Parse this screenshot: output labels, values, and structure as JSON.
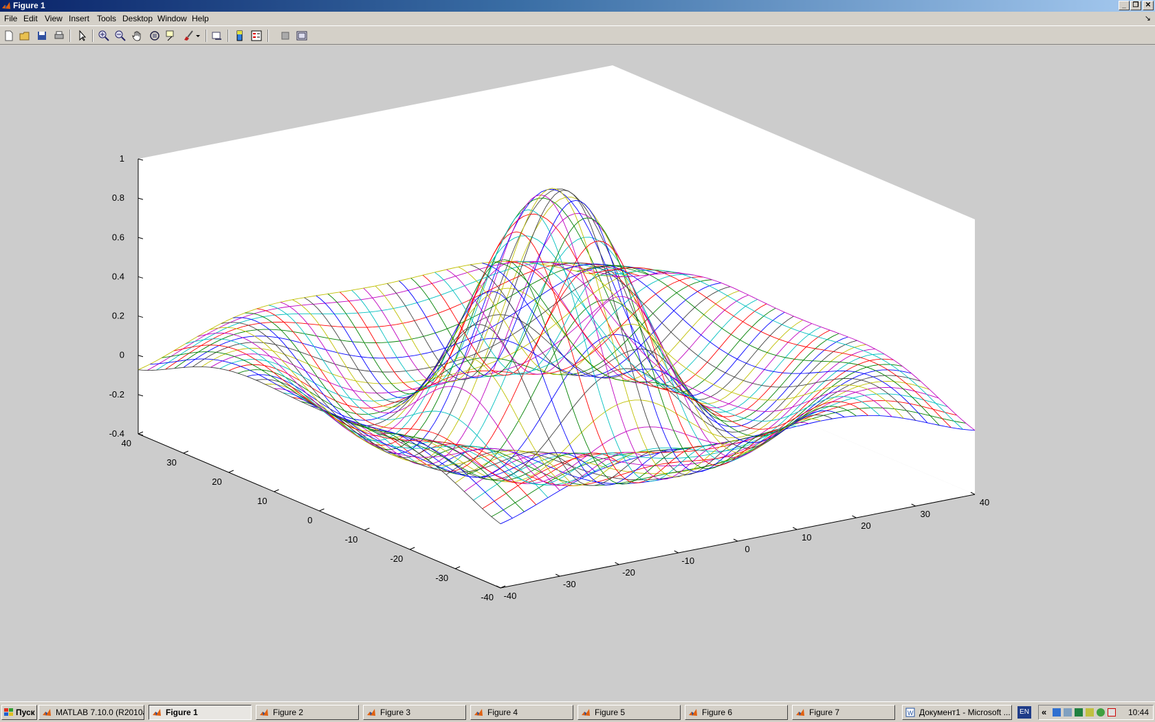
{
  "window": {
    "title": "Figure 1"
  },
  "window_buttons": [
    "minimize",
    "restore",
    "close"
  ],
  "menu": [
    "File",
    "Edit",
    "View",
    "Insert",
    "Tools",
    "Desktop",
    "Window",
    "Help"
  ],
  "toolbar": [
    "new-figure-icon",
    "open-file-icon",
    "save-icon",
    "print-icon",
    "edit-plot-icon",
    "zoom-in-icon",
    "zoom-out-icon",
    "pan-icon",
    "rotate-3d-icon",
    "data-cursor-icon",
    "brush-icon",
    "brush-dropdown-icon",
    "link-plot-icon",
    "insert-colorbar-icon",
    "insert-legend-icon",
    "hide-plot-tools-icon",
    "show-plot-tools-icon"
  ],
  "colors": {
    "axes_bg": "#ffffff",
    "figure_bg": "#cccccc",
    "titlebar_start": "#0a246a",
    "titlebar_end": "#a6caf0"
  },
  "chart_data": {
    "type": "mesh3d",
    "function": "sinc-like ripple: z = sin(r/5)/(r/5), r = sqrt(x^2+y^2), rendered as colored mesh lines",
    "x_ticks": [
      -40,
      -30,
      -20,
      -10,
      0,
      10,
      20,
      30,
      40
    ],
    "y_ticks": [
      -40,
      -30,
      -20,
      -10,
      0,
      10,
      20,
      30,
      40
    ],
    "z_ticks": [
      -0.4,
      -0.2,
      0,
      0.2,
      0.4,
      0.6,
      0.8,
      1
    ],
    "x_tick_labels": [
      "-40",
      "-30",
      "-20",
      "-10",
      "0",
      "10",
      "20",
      "30",
      "40"
    ],
    "y_tick_labels": [
      "-40",
      "-30",
      "-20",
      "-10",
      "0",
      "10",
      "20",
      "30",
      "40"
    ],
    "z_tick_labels": [
      "-0.4",
      "-0.2",
      "0",
      "0.2",
      "0.4",
      "0.6",
      "0.8",
      "1"
    ],
    "xlim": [
      -40,
      40
    ],
    "ylim": [
      -40,
      40
    ],
    "zlim": [
      -0.4,
      1
    ],
    "peak_z": 1,
    "line_colors": [
      "#0000ff",
      "#008000",
      "#ff0000",
      "#00bfbf",
      "#bf00bf",
      "#bfbf00",
      "#404040"
    ],
    "grid": "off",
    "title": "",
    "xlabel": "",
    "ylabel": "",
    "zlabel": ""
  },
  "taskbar": {
    "start_label": "Пуск",
    "items": [
      {
        "label": "MATLAB  7.10.0 (R2010a)",
        "active": false
      },
      {
        "label": "Figure 1",
        "active": true
      },
      {
        "label": "Figure 2",
        "active": false
      },
      {
        "label": "Figure 3",
        "active": false
      },
      {
        "label": "Figure 4",
        "active": false
      },
      {
        "label": "Figure 5",
        "active": false
      },
      {
        "label": "Figure 6",
        "active": false
      },
      {
        "label": "Figure 7",
        "active": false
      },
      {
        "label": "Документ1 - Microsoft ...",
        "active": false
      }
    ],
    "language": "EN",
    "clock": "10:44"
  }
}
